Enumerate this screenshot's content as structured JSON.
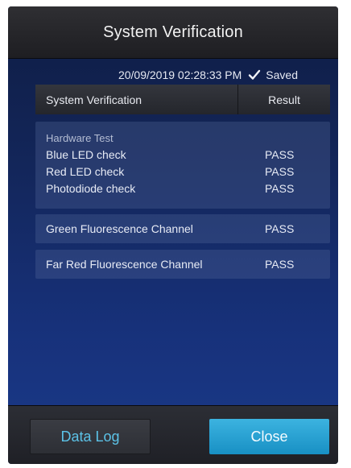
{
  "header": {
    "title": "System Verification"
  },
  "status": {
    "timestamp": "20/09/2019 02:28:33 PM",
    "saved_label": "Saved",
    "icon": "checkmark-icon"
  },
  "table": {
    "columns": [
      "System Verification",
      "Result"
    ],
    "hardware_group": {
      "title": "Hardware Test",
      "rows": [
        {
          "name": "Blue LED check",
          "result": "PASS"
        },
        {
          "name": "Red LED check",
          "result": "PASS"
        },
        {
          "name": "Photodiode check",
          "result": "PASS"
        }
      ]
    },
    "rows": [
      {
        "name": "Green Fluorescence Channel",
        "result": "PASS"
      },
      {
        "name": "Far Red Fluorescence Channel",
        "result": "PASS"
      }
    ]
  },
  "footer": {
    "data_log_label": "Data Log",
    "close_label": "Close"
  },
  "colors": {
    "accent": "#2aa7d8",
    "background": "#13265a"
  }
}
